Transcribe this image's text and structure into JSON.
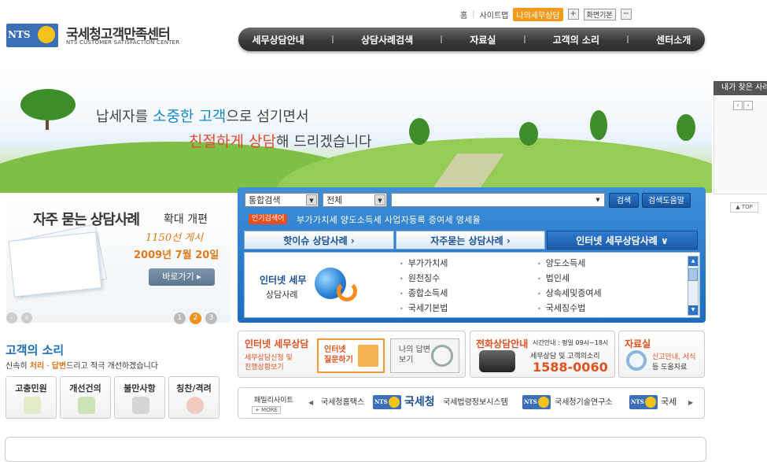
{
  "header": {
    "logo_mark": "NTS",
    "logo_title": "국세청고객만족센터",
    "logo_subtitle": "NTS CUSTOMER SATISFACTION CENTER",
    "util": {
      "home": "홈",
      "sitemap": "사이트맵",
      "my_tax": "나의세무상담",
      "zoom_in": "+",
      "zoom_default": "화면기본",
      "zoom_out": "−"
    },
    "nav": [
      "세무상담안내",
      "상담사례검색",
      "자료실",
      "고객의 소리",
      "센터소개"
    ]
  },
  "hero": {
    "line1_a": "납세자를 ",
    "line1_hl": "소중한 고객",
    "line1_b": "으로 섬기면서",
    "line2_hl": "친절하게 상담",
    "line2_b": "해 드리겠습니다"
  },
  "quick": {
    "title": "내가 찾은 사례",
    "prev": "‹",
    "next": "›",
    "top": "▲ TOP"
  },
  "promo": {
    "title": "자주 묻는 상담사례",
    "title2": "확대 개편",
    "handwritten": "1150선 게시",
    "date": "2009년 7월 20일",
    "button": "바로가기 ▸",
    "ctl_prev": "‹",
    "ctl_pause": "II",
    "pages": [
      "1",
      "2",
      "3"
    ]
  },
  "search": {
    "scope": "통합검색",
    "category": "전체",
    "query": "",
    "search_btn": "검색",
    "help_btn": "검색도움말",
    "hot_label": "인기검색어",
    "hot_words": "부가가치세  양도소득세  사업자등록  증여세  영세율",
    "tabs": [
      "핫이슈 상담사례  ›",
      "자주묻는 상담사례  ›",
      "인터넷 세무상담사례  ∨"
    ],
    "panel_title": "인터넷 세무",
    "panel_sub": "상담사례",
    "categories_left": [
      "부가가치세",
      "원천징수",
      "종합소득세",
      "국세기본법"
    ],
    "categories_right": [
      "양도소득세",
      "법인세",
      "상속세및증여세",
      "국세징수법"
    ]
  },
  "voice": {
    "title": "고객의 소리",
    "desc_a": "신속히 ",
    "desc_o1": "처리",
    "desc_dot": " · ",
    "desc_o2": "답변",
    "desc_b": "드리고 적극 개선하겠습니다",
    "items": [
      "고충민원",
      "개선건의",
      "불만사항",
      "칭찬/격려"
    ]
  },
  "services": {
    "internet": {
      "title": "인터넷 세무상담",
      "line1": "세무상담신청 및",
      "line2": "진행상황보기",
      "btn1": "인터넷 질문하기",
      "btn2": "나의 답변보기"
    },
    "phone": {
      "title": "전화상담안내",
      "time": "시간안내 : 평일 09시~18시",
      "sub": "세무상담 및 고객의소리",
      "number": "1588-0060"
    },
    "library": {
      "title": "자료실",
      "line1": "신고안내, 서식",
      "line2": "등 도움자료"
    }
  },
  "family": {
    "title": "패밀리사이트",
    "more": "+ MORE",
    "prev": "◀",
    "next": "▶",
    "sites": [
      "국세청홈택스",
      "국세청",
      "국세법령정보시스템",
      "국세청기술연구소",
      "국세"
    ]
  },
  "colors": {
    "accent_blue": "#1f6cbf",
    "accent_orange": "#e0521f",
    "nav_dark": "#3a3a3a"
  }
}
